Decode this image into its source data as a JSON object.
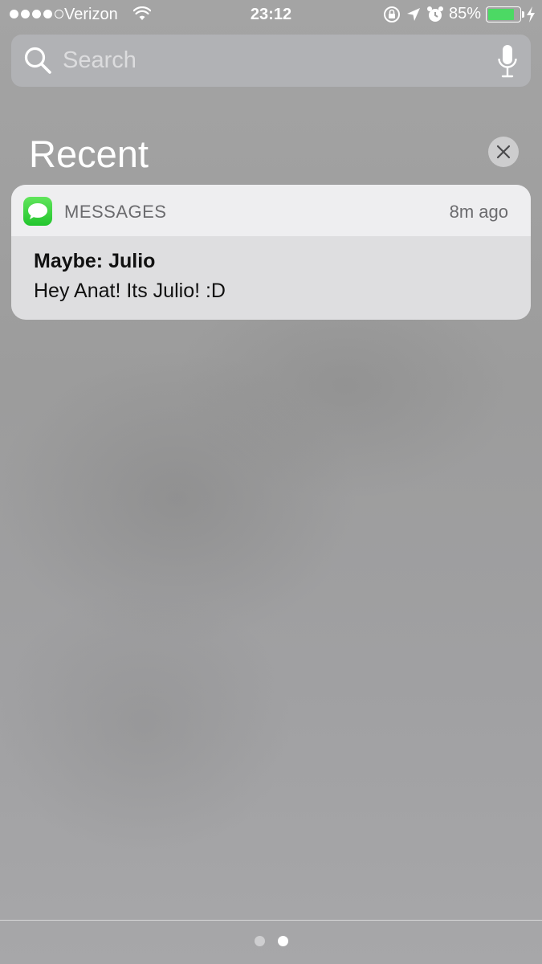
{
  "status_bar": {
    "carrier": "Verizon",
    "signal_bars": 4,
    "signal_total": 5,
    "time": "23:12",
    "battery_percent": "85%",
    "battery_level": 0.85,
    "icons": [
      "wifi-icon",
      "rotation-lock-icon",
      "location-arrow-icon",
      "alarm-icon",
      "battery-icon",
      "charging-bolt-icon"
    ]
  },
  "search": {
    "placeholder": "Search",
    "value": "",
    "icons": [
      "search-icon",
      "microphone-icon"
    ]
  },
  "recent": {
    "title": "Recent",
    "clear_icon": "close-icon"
  },
  "notifications": [
    {
      "app": "MESSAGES",
      "app_icon": "messages-app-icon",
      "app_color": "#34c759",
      "time": "8m ago",
      "title": "Maybe: Julio",
      "message": "Hey Anat! Its Julio! :D"
    }
  ],
  "pager": {
    "pages": 2,
    "active_index": 1
  },
  "colors": {
    "background": "#a2a2a4",
    "battery_fill": "#4cd964",
    "messages_green": "#34c759"
  }
}
